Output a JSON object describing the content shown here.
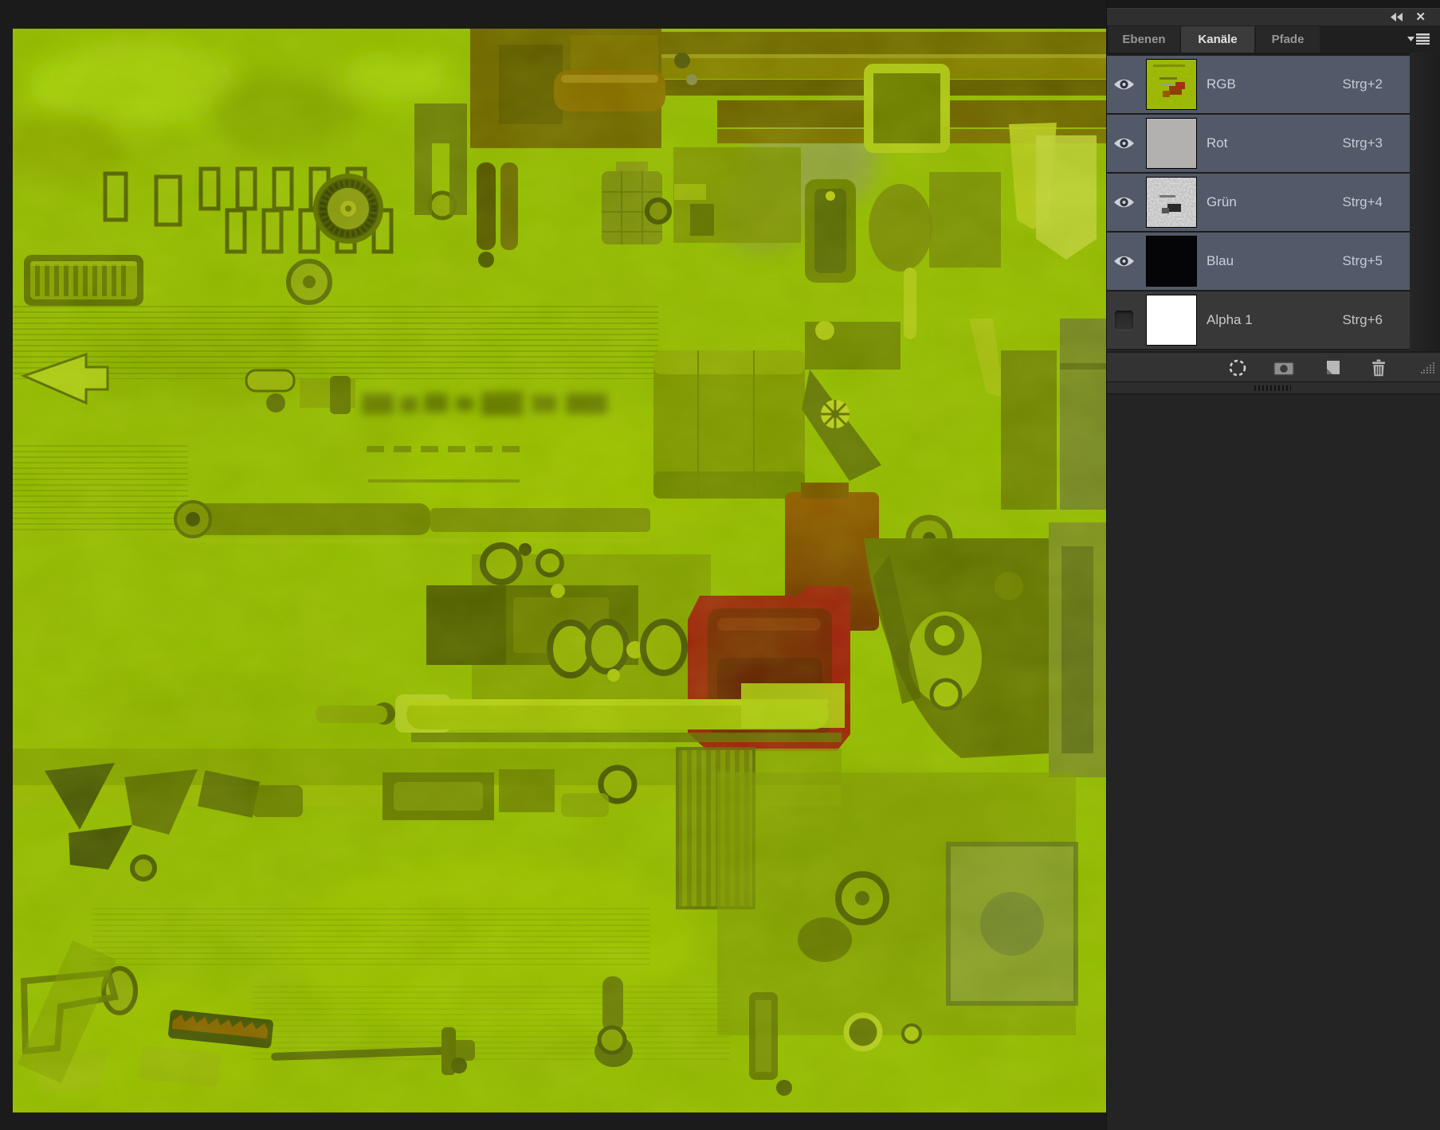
{
  "window": {
    "collapse_icon": "collapse-to-icons",
    "close_glyph": "✕"
  },
  "panel": {
    "tabs": [
      {
        "label": "Ebenen",
        "active": false
      },
      {
        "label": "Kanäle",
        "active": true
      },
      {
        "label": "Pfade",
        "active": false
      }
    ],
    "channels": [
      {
        "name": "RGB",
        "shortcut": "Strg+2",
        "visible": true,
        "selected": true,
        "thumbnail": "color-texture"
      },
      {
        "name": "Rot",
        "shortcut": "Strg+3",
        "visible": true,
        "selected": true,
        "thumbnail": "solid-light-gray"
      },
      {
        "name": "Grün",
        "shortcut": "Strg+4",
        "visible": true,
        "selected": true,
        "thumbnail": "grayscale-noise"
      },
      {
        "name": "Blau",
        "shortcut": "Strg+5",
        "visible": true,
        "selected": true,
        "thumbnail": "solid-black"
      },
      {
        "name": "Alpha 1",
        "shortcut": "Strg+6",
        "visible": false,
        "selected": false,
        "thumbnail": "solid-white"
      }
    ],
    "footer_icons": [
      "load-channel-as-selection",
      "save-selection-as-channel",
      "new-channel",
      "delete-channel"
    ],
    "colors": {
      "selected_row": "#525968",
      "panel_bg": "#333333",
      "active_tab_bg": "#3b3b3b",
      "row_text": "#ccd0d8"
    }
  },
  "canvas": {
    "content": "texture-atlas-image-green-channel-tint",
    "dominant_color": "#96c203",
    "accent_colors": [
      "#a31111",
      "#6e6000",
      "#b6d41a",
      "#4e5c04"
    ]
  }
}
